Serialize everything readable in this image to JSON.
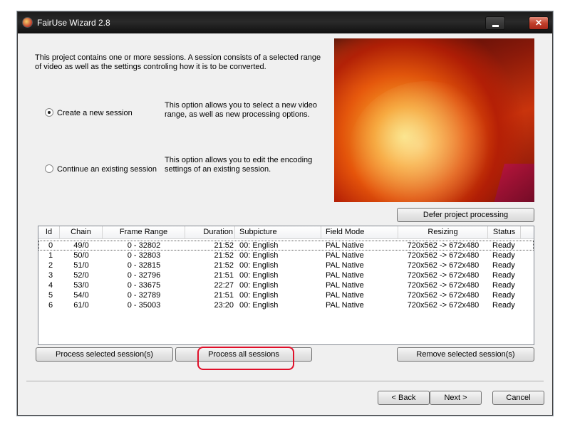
{
  "window": {
    "title": "FairUse Wizard 2.8"
  },
  "titlebar": {
    "minimize_glyph": "",
    "close_glyph": "✕"
  },
  "intro": "This project contains one or more sessions. A session consists of a selected range of video as well as the settings controling how it is to be converted.",
  "options": [
    {
      "label": "Create a new session",
      "checked": true,
      "description": "This option allows you to select a new video range, as well as new processing options."
    },
    {
      "label": "Continue an existing session",
      "checked": false,
      "description": "This option allows you to edit the encoding settings of an existing session."
    }
  ],
  "buttons": {
    "defer": "Defer project processing",
    "process_selected": "Process selected session(s)",
    "process_all": "Process all sessions",
    "remove_selected": "Remove selected session(s)",
    "back": "< Back",
    "next": "Next >",
    "cancel": "Cancel"
  },
  "sessions": {
    "columns": [
      "Id",
      "Chain",
      "Frame Range",
      "Duration",
      "Subpicture",
      "Field Mode",
      "Resizing",
      "Status"
    ],
    "rows": [
      [
        "0",
        "49/0",
        "0 - 32802",
        "21:52",
        "00: English",
        "PAL Native",
        "720x562 -> 672x480",
        "Ready"
      ],
      [
        "1",
        "50/0",
        "0 - 32803",
        "21:52",
        "00: English",
        "PAL Native",
        "720x562 -> 672x480",
        "Ready"
      ],
      [
        "2",
        "51/0",
        "0 - 32815",
        "21:52",
        "00: English",
        "PAL Native",
        "720x562 -> 672x480",
        "Ready"
      ],
      [
        "3",
        "52/0",
        "0 - 32796",
        "21:51",
        "00: English",
        "PAL Native",
        "720x562 -> 672x480",
        "Ready"
      ],
      [
        "4",
        "53/0",
        "0 - 33675",
        "22:27",
        "00: English",
        "PAL Native",
        "720x562 -> 672x480",
        "Ready"
      ],
      [
        "5",
        "54/0",
        "0 - 32789",
        "21:51",
        "00: English",
        "PAL Native",
        "720x562 -> 672x480",
        "Ready"
      ],
      [
        "6",
        "61/0",
        "0 - 35003",
        "23:20",
        "00: English",
        "PAL Native",
        "720x562 -> 672x480",
        "Ready"
      ]
    ]
  },
  "colors": {
    "callout": "#e0102a",
    "face": "#f0f0f0",
    "titlebar": "#1c1c1c"
  }
}
